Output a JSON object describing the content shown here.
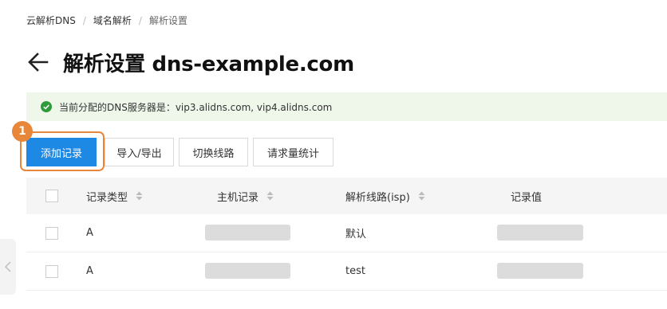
{
  "breadcrumb": {
    "items": [
      "云解析DNS",
      "域名解析",
      "解析设置"
    ],
    "separator": "/"
  },
  "header": {
    "title": "解析设置 dns-example.com",
    "back_icon": "arrow-left-icon"
  },
  "notice": {
    "icon": "check-circle-icon",
    "text": "当前分配的DNS服务器是：vip3.alidns.com, vip4.alidns.com",
    "color": "#2e9b3a"
  },
  "toolbar": {
    "add_record": "添加记录",
    "import_export": "导入/导出",
    "switch_line": "切换线路",
    "request_stats": "请求量统计"
  },
  "annotation": {
    "step_number": "1",
    "color": "#e8863a"
  },
  "table": {
    "columns": [
      "记录类型",
      "主机记录",
      "解析线路(isp)",
      "记录值"
    ],
    "rows": [
      {
        "type": "A",
        "host": "",
        "line": "默认",
        "value": ""
      },
      {
        "type": "A",
        "host": "",
        "line": "test",
        "value": ""
      }
    ]
  },
  "colors": {
    "primary": "#1e88e5",
    "notice_bg": "#eef7ea",
    "highlight": "#e8863a"
  }
}
